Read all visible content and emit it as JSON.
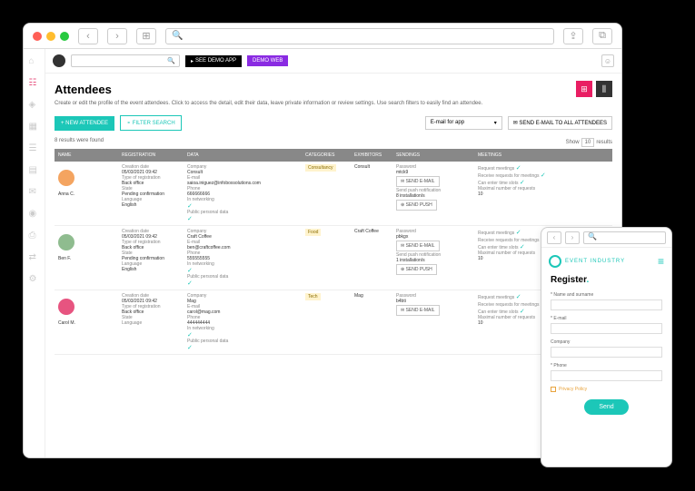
{
  "toolbar": {
    "demo_app": "SEE DEMO APP",
    "demo_web": "DEMO WEB"
  },
  "page": {
    "title": "Attendees",
    "desc": "Create or edit the profile of the event attendees. Click to access the detail, edit their data, leave private information or review settings. Use search filters to easily find an attendee."
  },
  "actions": {
    "new": "+ NEW ATTENDEE",
    "filter": "⚬ FILTER SEARCH",
    "email_sel": "E-mail for app",
    "send_all": "✉ SEND E-MAIL TO ALL ATTENDEES"
  },
  "results": {
    "found": "8 results were found",
    "show": "Show",
    "num": "10",
    "suffix": "results"
  },
  "headers": {
    "name": "NAME",
    "reg": "REGISTRATION",
    "data": "DATA",
    "cat": "CATEGORIES",
    "exh": "EXHIBITORS",
    "send": "SENDINGS",
    "meet": "MEETINGS"
  },
  "labels": {
    "cdate": "Creation date",
    "treg": "Type of registration",
    "state": "State",
    "lang": "Language",
    "company": "Company",
    "email": "E-mail",
    "phone": "Phone",
    "innet": "In networking",
    "ppd": "Public personal data",
    "pwd": "Password",
    "spn": "Send push notification",
    "inst8": "8 installation/s",
    "inst1": "1 installation/s",
    "reqm": "Request meetings",
    "recv": "Receive requests for meetings",
    "enter": "Can enter time slots",
    "maxm": "Maximal number of requests",
    "ten": "10",
    "sendemail": "✉ SEND E-MAIL",
    "sendpush": "⊕ SEND PUSH"
  },
  "rows": [
    {
      "name": "Anna C.",
      "avatar": "#f4a460",
      "cdate": "05/03/2021 09:42",
      "treg": "Back office",
      "state": "Pending confirmation",
      "lang": "English",
      "company": "Consult",
      "email": "saioa.iniguez@infoboxsolutions.com",
      "phone": "666666666",
      "cat": "Consultancy",
      "exh": "Consult",
      "pwd": "mtck9",
      "inst": "inst8"
    },
    {
      "name": "Ben F.",
      "avatar": "#8fbc8f",
      "cdate": "05/03/2021 09:42",
      "treg": "Back office",
      "state": "Pending confirmation",
      "lang": "English",
      "company": "Craft Coffee",
      "email": "ben@craftcoffee.com",
      "phone": "555555555",
      "cat": "Food",
      "exh": "Craft Coffee",
      "pwd": "pbkgx",
      "inst": "inst1"
    },
    {
      "name": "Carol M.",
      "avatar": "#e75480",
      "cdate": "05/03/2021 09:42",
      "treg": "Back office",
      "state": "",
      "lang": "",
      "company": "Mag",
      "email": "carol@mag.com",
      "phone": "444444444",
      "cat": "Tech",
      "exh": "Mag",
      "pwd": "b4bti",
      "inst": ""
    }
  ],
  "mobile": {
    "brand": "EVENT INDUSTRY",
    "title": "Register",
    "fields": {
      "name": "* Name and surname",
      "email": "* E-mail",
      "company": "Company",
      "phone": "* Phone"
    },
    "privacy": "Privacy Policy",
    "send": "Send"
  }
}
